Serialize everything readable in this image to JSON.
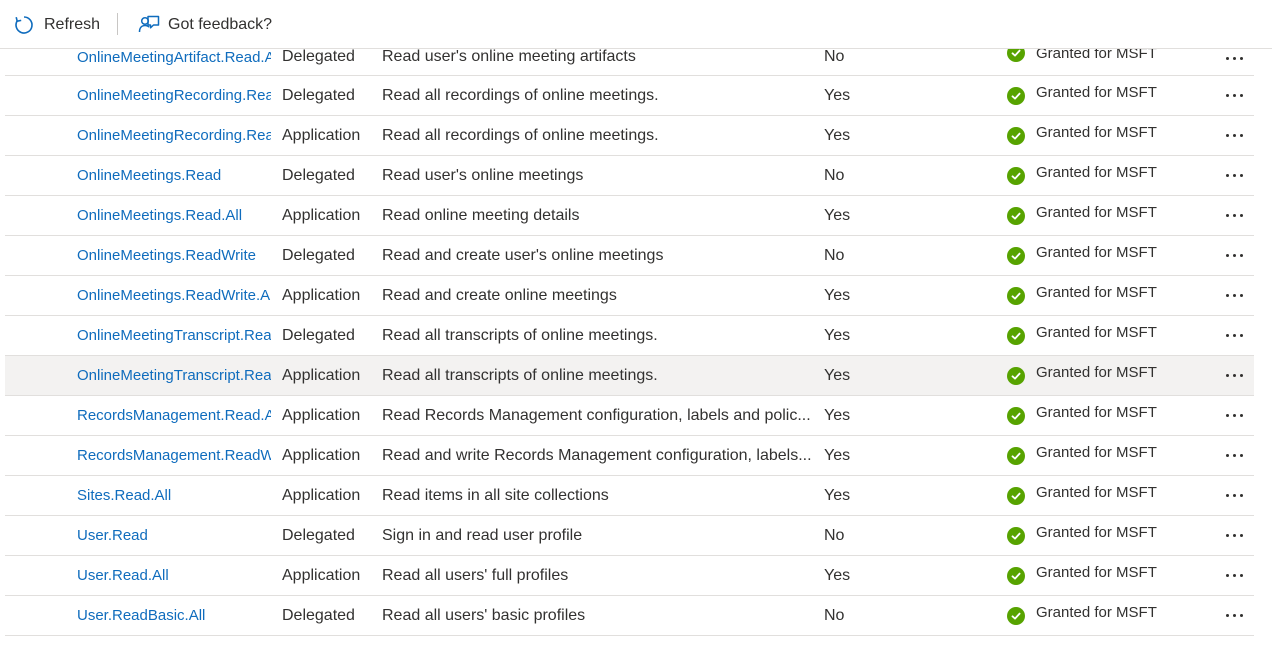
{
  "toolbar": {
    "refresh_label": "Refresh",
    "feedback_label": "Got feedback?"
  },
  "colors": {
    "link": "#0f6cbd",
    "granted": "#57a300",
    "hover_row": "#f3f2f1"
  },
  "rows": [
    {
      "name": "OnlineMeetingArtifact.Read.A",
      "type": "Delegated",
      "description": "Read user's online meeting artifacts",
      "admin_consent": "No",
      "status": "Granted for MSFT"
    },
    {
      "name": "OnlineMeetingRecording.Rea",
      "type": "Delegated",
      "description": "Read all recordings of online meetings.",
      "admin_consent": "Yes",
      "status": "Granted for MSFT"
    },
    {
      "name": "OnlineMeetingRecording.Rea",
      "type": "Application",
      "description": "Read all recordings of online meetings.",
      "admin_consent": "Yes",
      "status": "Granted for MSFT"
    },
    {
      "name": "OnlineMeetings.Read",
      "type": "Delegated",
      "description": "Read user's online meetings",
      "admin_consent": "No",
      "status": "Granted for MSFT"
    },
    {
      "name": "OnlineMeetings.Read.All",
      "type": "Application",
      "description": "Read online meeting details",
      "admin_consent": "Yes",
      "status": "Granted for MSFT"
    },
    {
      "name": "OnlineMeetings.ReadWrite",
      "type": "Delegated",
      "description": "Read and create user's online meetings",
      "admin_consent": "No",
      "status": "Granted for MSFT"
    },
    {
      "name": "OnlineMeetings.ReadWrite.Al",
      "type": "Application",
      "description": "Read and create online meetings",
      "admin_consent": "Yes",
      "status": "Granted for MSFT"
    },
    {
      "name": "OnlineMeetingTranscript.Rea",
      "type": "Delegated",
      "description": "Read all transcripts of online meetings.",
      "admin_consent": "Yes",
      "status": "Granted for MSFT"
    },
    {
      "name": "OnlineMeetingTranscript.Rea",
      "type": "Application",
      "description": "Read all transcripts of online meetings.",
      "admin_consent": "Yes",
      "status": "Granted for MSFT"
    },
    {
      "name": "RecordsManagement.Read.Al",
      "type": "Application",
      "description": "Read Records Management configuration, labels and polic...",
      "admin_consent": "Yes",
      "status": "Granted for MSFT"
    },
    {
      "name": "RecordsManagement.ReadW",
      "type": "Application",
      "description": "Read and write Records Management configuration, labels...",
      "admin_consent": "Yes",
      "status": "Granted for MSFT"
    },
    {
      "name": "Sites.Read.All",
      "type": "Application",
      "description": "Read items in all site collections",
      "admin_consent": "Yes",
      "status": "Granted for MSFT"
    },
    {
      "name": "User.Read",
      "type": "Delegated",
      "description": "Sign in and read user profile",
      "admin_consent": "No",
      "status": "Granted for MSFT"
    },
    {
      "name": "User.Read.All",
      "type": "Application",
      "description": "Read all users' full profiles",
      "admin_consent": "Yes",
      "status": "Granted for MSFT"
    },
    {
      "name": "User.ReadBasic.All",
      "type": "Delegated",
      "description": "Read all users' basic profiles",
      "admin_consent": "No",
      "status": "Granted for MSFT"
    }
  ]
}
